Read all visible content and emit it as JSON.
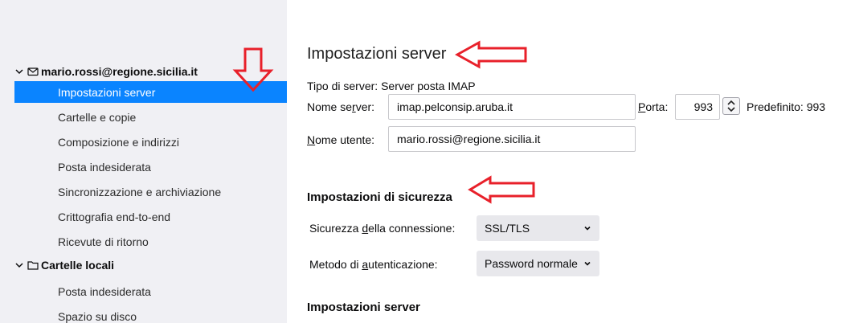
{
  "sidebar": {
    "account": {
      "email": "mario.rossi@regione.sicilia.it"
    },
    "account_items": [
      "Impostazioni server",
      "Cartelle e copie",
      "Composizione e indirizzi",
      "Posta indesiderata",
      "Sincronizzazione e archiviazione",
      "Crittografia end-to-end",
      "Ricevute di ritorno"
    ],
    "local": {
      "label": "Cartelle locali"
    },
    "local_items": [
      "Posta indesiderata",
      "Spazio su disco"
    ]
  },
  "main": {
    "title": "Impostazioni server",
    "server_type_label": "Tipo di server:",
    "server_type_value": "Server posta IMAP",
    "server_name_label_pre": "Nome se",
    "server_name_label_acc": "r",
    "server_name_label_post": "ver:",
    "server_name_value": "imap.pelconsip.aruba.it",
    "port_label_acc": "P",
    "port_label_post": "orta:",
    "port_value": "993",
    "port_default": "Predefinito: 993",
    "username_label_acc": "N",
    "username_label_post": "ome utente:",
    "username_value": "mario.rossi@regione.sicilia.it",
    "security_heading": "Impostazioni di sicurezza",
    "connection_security_label_pre": "Sicurezza ",
    "connection_security_label_acc": "d",
    "connection_security_label_post": "ella connessione:",
    "connection_security_value": "SSL/TLS",
    "auth_label_pre": "Metodo di ",
    "auth_label_acc": "a",
    "auth_label_post": "utenticazione:",
    "auth_value": "Password normale",
    "server_settings_heading": "Impostazioni server"
  },
  "colors": {
    "selected": "#0a84ff",
    "annotation_arrow": "#e8202a"
  }
}
